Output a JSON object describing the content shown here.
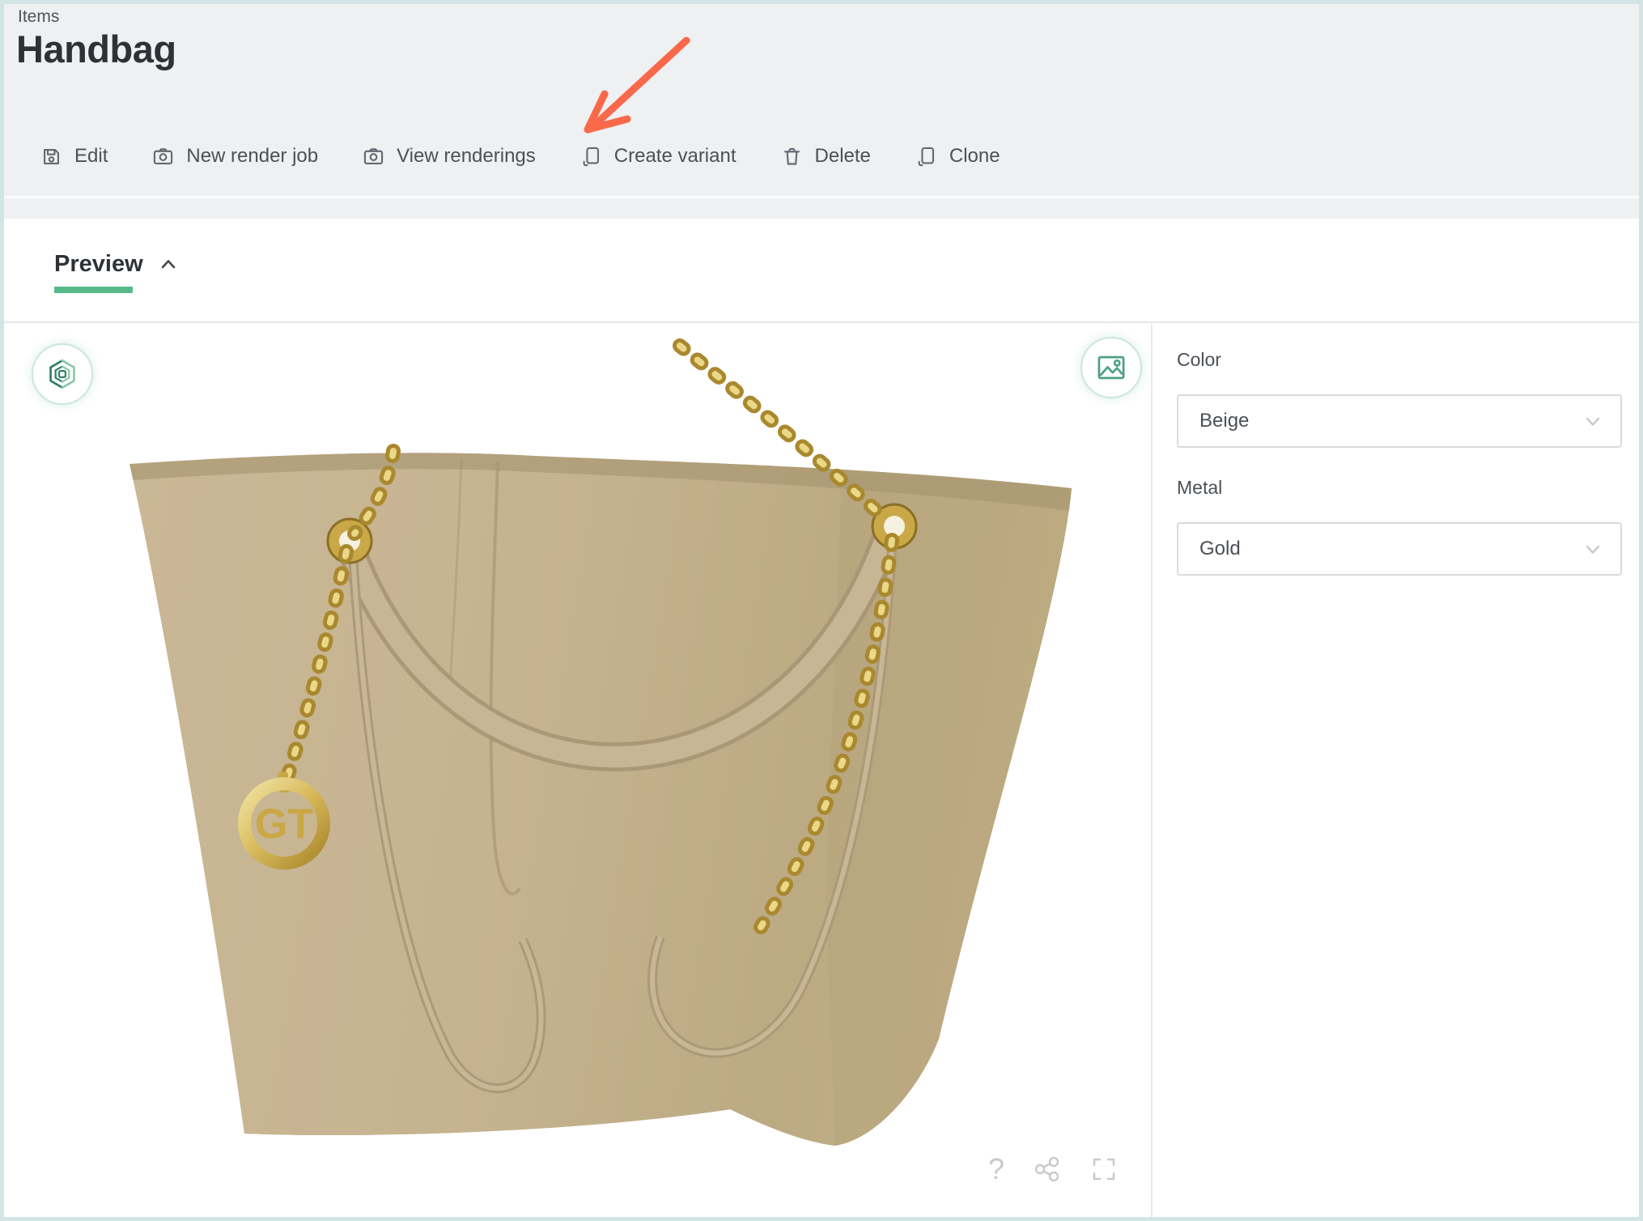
{
  "page": {
    "breadcrumb": "Items",
    "title": "Handbag"
  },
  "toolbar": {
    "actions": [
      {
        "label": "Edit",
        "icon": "save-icon"
      },
      {
        "label": "New render job",
        "icon": "camera-icon"
      },
      {
        "label": "View renderings",
        "icon": "camera-icon"
      },
      {
        "label": "Create variant",
        "icon": "copy-icon"
      },
      {
        "label": "Delete",
        "icon": "trash-icon"
      },
      {
        "label": "Clone",
        "icon": "copy-icon"
      }
    ]
  },
  "tabs": {
    "preview": {
      "label": "Preview",
      "state": "expanded"
    }
  },
  "viewer": {
    "type": "3d-product-preview",
    "product": "Beige quilted tote handbag with gold chain straps and medallion",
    "medallion_monogram": "GT",
    "help_glyph": "?"
  },
  "options": {
    "fields": [
      {
        "label": "Color",
        "value": "Beige"
      },
      {
        "label": "Metal",
        "value": "Gold"
      }
    ]
  },
  "annotation": {
    "type": "arrow",
    "points_at": "View renderings",
    "color": "#f8694b"
  },
  "colors": {
    "frame_border": "#d2e4e4",
    "header_bg": "#eff0f2",
    "accent_green": "#58ba8b",
    "divider": "#e7e8ea",
    "bag_beige": "#c5b28f",
    "gold": "#c9a845",
    "toolbar_icon": "#65696f",
    "muted_icon": "#c9c9c9"
  }
}
